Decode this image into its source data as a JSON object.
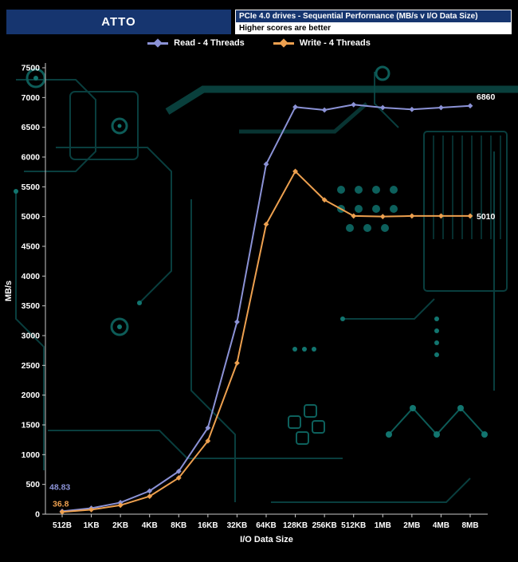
{
  "header": {
    "app_title": "ATTO",
    "chart_title": "PCIe 4.0 drives - Sequential Performance (MB/s v I/O Data Size)",
    "subtitle": "Higher scores are better"
  },
  "legend": [
    {
      "label": "Read - 4 Threads",
      "color": "#8b92d6"
    },
    {
      "label": "Write - 4 Threads",
      "color": "#eda04f"
    }
  ],
  "chart_data": {
    "type": "line",
    "title": "PCIe 4.0 drives - Sequential Performance (MB/s v I/O Data Size)",
    "subtitle": "Higher scores are better",
    "xlabel": "I/O Data Size",
    "ylabel": "MB/s",
    "ylim": [
      0,
      7500
    ],
    "ytick_step": 500,
    "grid": false,
    "legend_position": "top",
    "categories": [
      "512B",
      "1KB",
      "2KB",
      "4KB",
      "8KB",
      "16KB",
      "32KB",
      "64KB",
      "128KB",
      "256KB",
      "512KB",
      "1MB",
      "2MB",
      "4MB",
      "8MB"
    ],
    "series": [
      {
        "name": "Read - 4 Threads",
        "color": "#8b92d6",
        "values": [
          48.83,
          100,
          195,
          390,
          720,
          1450,
          3230,
          5880,
          6840,
          6790,
          6880,
          6830,
          6800,
          6830,
          6860
        ]
      },
      {
        "name": "Write - 4 Threads",
        "color": "#eda04f",
        "values": [
          36.8,
          75,
          150,
          300,
          610,
          1230,
          2540,
          4870,
          5760,
          5280,
          5010,
          5000,
          5010,
          5010,
          5010
        ]
      }
    ],
    "annotations": {
      "read_start": "48.83",
      "write_start": "36.8",
      "read_end": "6860",
      "write_end": "5010"
    },
    "colors": {
      "background": "#000000",
      "axis": "#c9c9c9",
      "tick_text": "#ffffff",
      "header_blue": "#16356f"
    }
  }
}
